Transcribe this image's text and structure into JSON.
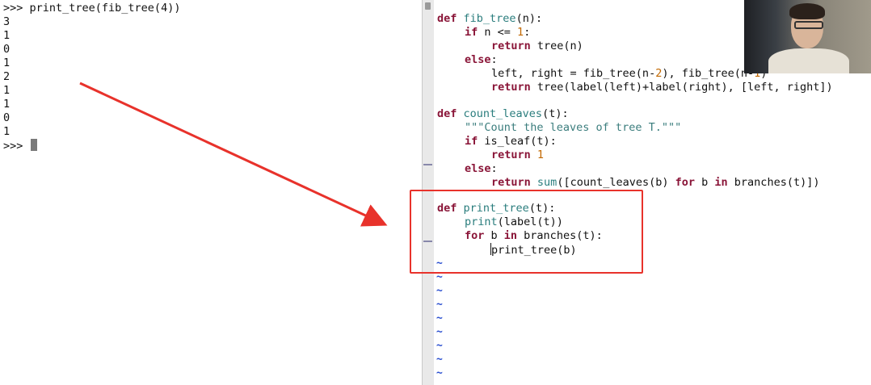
{
  "terminal": {
    "command_line": ">>> print_tree(fib_tree(4))",
    "outputs": [
      "3",
      "1",
      "0",
      "1",
      "2",
      "1",
      "1",
      "0",
      "1"
    ],
    "prompt": ">>> "
  },
  "editor": {
    "fib_tree": {
      "def_kw": "def",
      "name": "fib_tree",
      "params": "(n):",
      "if_kw": "if",
      "if_cond_a": " n <= ",
      "if_num": "1",
      "if_colon": ":",
      "return_kw": "return",
      "return_expr": " tree(n)",
      "else_kw": "else",
      "else_colon": ":",
      "assign_a": "left, right = fib_tree(n-",
      "assign_num1": "2",
      "assign_b": "), fib_tree(n-",
      "assign_num2": "1",
      "assign_c": ")",
      "return2_kw": "return",
      "return2_expr": " tree(label(left)+label(right), [left, right])"
    },
    "count_leaves": {
      "def_kw": "def",
      "name": "count_leaves",
      "params": "(t):",
      "docstring": "\"\"\"Count the leaves of tree T.\"\"\"",
      "if_kw": "if",
      "if_cond": " is_leaf(t):",
      "return_kw": "return",
      "return_num": "1",
      "else_kw": "else",
      "else_colon": ":",
      "return2_kw": "return",
      "sum_kw": "sum",
      "expr_a": "([count_leaves(b) ",
      "for_kw": "for",
      "expr_b": " b ",
      "in_kw": "in",
      "expr_c": " branches(t)])"
    },
    "print_tree": {
      "def_kw": "def",
      "name": "print_tree",
      "params": "(t):",
      "print_kw": "print",
      "print_args": "(label(t))",
      "for_kw": "for",
      "for_mid": " b ",
      "in_kw": "in",
      "for_iter": " branches(t):",
      "call_first": "p",
      "call_rest": "rint_tree(b)"
    },
    "tilde_char": "~"
  },
  "colors": {
    "keyword": "#8a1538",
    "function_name": "#2a7d7d",
    "number": "#c26800",
    "tilde": "#2a4fd0",
    "annotation": "#e8322b"
  },
  "annotations": {
    "arrow_icon": "red-arrow-pointing-to-print-tree",
    "highlight": "red-box-around-print-tree"
  }
}
